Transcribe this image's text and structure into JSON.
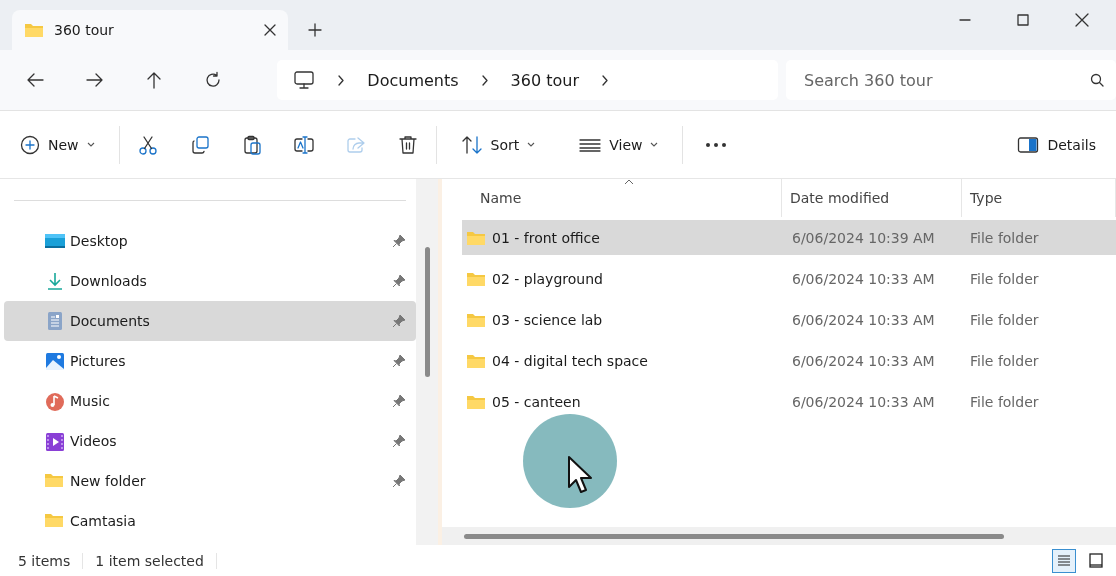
{
  "tabs": [
    {
      "label": "360 tour",
      "selected": true
    }
  ],
  "breadcrumb": [
    "Documents",
    "360 tour"
  ],
  "search": {
    "placeholder": "Search 360 tour"
  },
  "toolbar": {
    "new": "New",
    "actions": [
      {
        "kind": "cut",
        "disabled": false
      },
      {
        "kind": "copy",
        "disabled": false
      },
      {
        "kind": "paste",
        "disabled": false
      },
      {
        "kind": "rename",
        "disabled": false
      },
      {
        "kind": "share",
        "disabled": true
      },
      {
        "kind": "delete",
        "disabled": false
      }
    ],
    "sort": "Sort",
    "view": "View",
    "details": "Details"
  },
  "sidebar": {
    "items": [
      {
        "label": "Desktop",
        "kind": "desktop",
        "pinned": true,
        "selected": false
      },
      {
        "label": "Downloads",
        "kind": "downloads",
        "pinned": true,
        "selected": false
      },
      {
        "label": "Documents",
        "kind": "documents",
        "pinned": true,
        "selected": true
      },
      {
        "label": "Pictures",
        "kind": "pictures",
        "pinned": true,
        "selected": false
      },
      {
        "label": "Music",
        "kind": "music",
        "pinned": true,
        "selected": false
      },
      {
        "label": "Videos",
        "kind": "videos",
        "pinned": true,
        "selected": false
      },
      {
        "label": "New folder",
        "kind": "folder",
        "pinned": true,
        "selected": false
      },
      {
        "label": "Camtasia",
        "kind": "folder",
        "pinned": false,
        "selected": false
      }
    ]
  },
  "table": {
    "columns": [
      "Name",
      "Date modified",
      "Type"
    ],
    "rows": [
      {
        "name": "01 - front office",
        "date": "6/06/2024 10:39 AM",
        "type": "File folder",
        "selected": true
      },
      {
        "name": "02 - playground",
        "date": "6/06/2024 10:33 AM",
        "type": "File folder",
        "selected": false
      },
      {
        "name": "03 - science lab",
        "date": "6/06/2024 10:33 AM",
        "type": "File folder",
        "selected": false
      },
      {
        "name": "04 - digital tech space",
        "date": "6/06/2024 10:33 AM",
        "type": "File folder",
        "selected": false
      },
      {
        "name": "05 - canteen",
        "date": "6/06/2024 10:33 AM",
        "type": "File folder",
        "selected": false
      }
    ]
  },
  "status_bar": {
    "count": "5 items",
    "selection": "1 item selected"
  },
  "view_modes": [
    {
      "kind": "details",
      "selected": true
    },
    {
      "kind": "tiles",
      "selected": false
    }
  ]
}
